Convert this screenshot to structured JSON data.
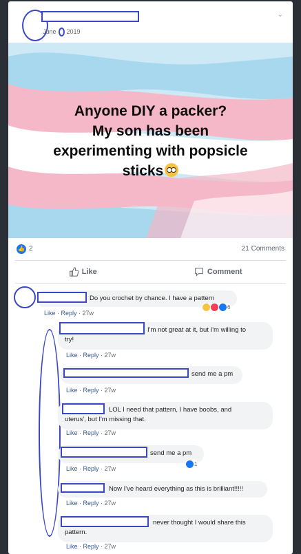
{
  "post": {
    "date_month": "June",
    "date_year": "2019",
    "image_text_lines": [
      "Anyone DIY a packer?",
      "My son has been",
      "experimenting with popsicle",
      "sticks"
    ],
    "reactions_count": "2",
    "comments_count": "21 Comments",
    "like_label": "Like",
    "comment_label": "Comment"
  },
  "flag_colors": {
    "blue": "#a8d8ee",
    "pink": "#f4b8c8",
    "white": "#ffffff",
    "accent": "#1877f2"
  },
  "comments": [
    {
      "text": "Do you crochet by chance. I have a pattern",
      "like": "Like",
      "reply": "Reply",
      "time": "27w",
      "reactions": "6"
    },
    {
      "text_1": "I'm not great at it, but I'm willing to",
      "text_2": "try!",
      "like": "Like",
      "reply": "Reply",
      "time": "27w"
    },
    {
      "text": "send me a pm",
      "like": "Like",
      "reply": "Reply",
      "time": "27w"
    },
    {
      "text_1": "LOL I need that pattern, I have boobs, and",
      "text_2": "uterus', but I'm missing that.",
      "like": "Like",
      "reply": "Reply",
      "time": "27w"
    },
    {
      "text": "send me a pm",
      "like": "Like",
      "reply": "Reply",
      "time": "27w",
      "reactions": "1"
    },
    {
      "text": "Now I've heard everything as this is brilliant!!!!!",
      "like": "Like",
      "reply": "Reply",
      "time": "27w"
    },
    {
      "text_1": "never thought I would share this",
      "text_2": "pattern.",
      "like": "Like",
      "reply": "Reply",
      "time": "27w"
    }
  ],
  "icons": {
    "like": "thumbs-up-icon",
    "comment": "speech-bubble-icon",
    "menu": "chevron-down-icon"
  }
}
